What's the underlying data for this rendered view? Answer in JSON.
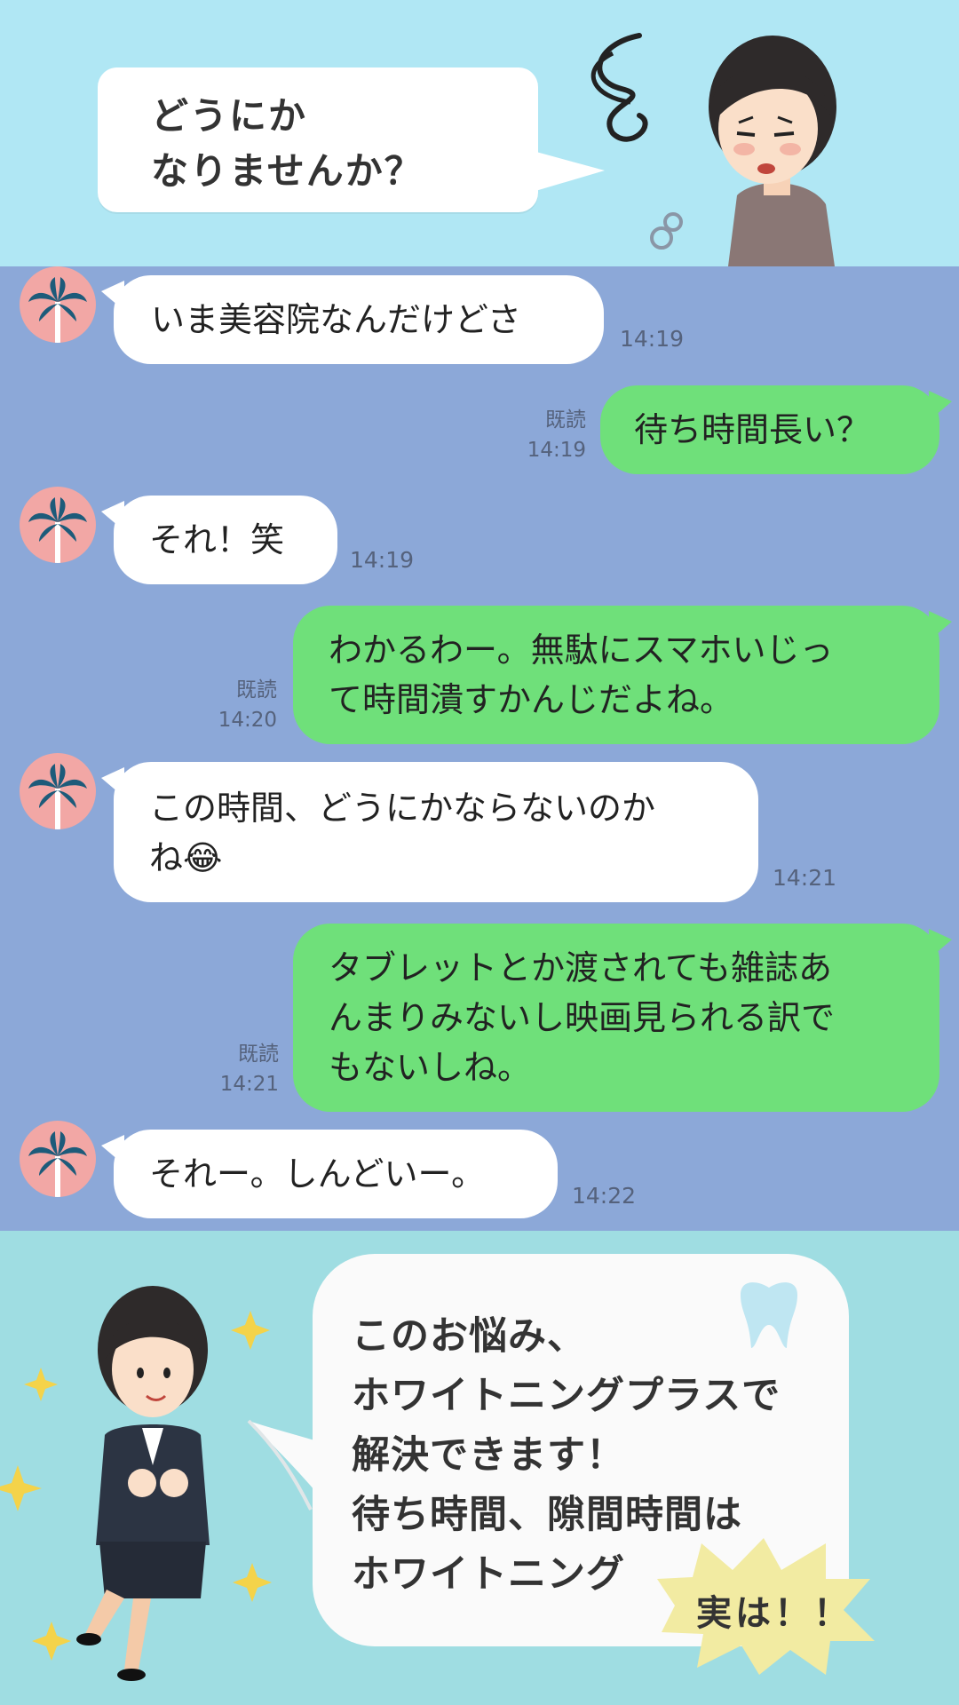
{
  "header": {
    "speech": "どうにか\nなりませんか？"
  },
  "messages": [
    {
      "side": "left",
      "text": "いま美容院なんだけどさ",
      "time": "14:19"
    },
    {
      "side": "right",
      "text": "待ち時間長い？",
      "read": "既読",
      "time": "14:19"
    },
    {
      "side": "left",
      "text": "それ！笑",
      "time": "14:19"
    },
    {
      "side": "right",
      "line1": "わかるわー。無駄にスマホいじっ",
      "line2": "て時間潰すかんじだよね。",
      "read": "既読",
      "time": "14:20"
    },
    {
      "side": "left",
      "line1": "この時間、どうにかならないのか",
      "line2": "ね",
      "emoji": "😂",
      "time": "14:21"
    },
    {
      "side": "right",
      "line1": "タブレットとか渡されても雑誌あ",
      "line2": "んまりみないし映画見られる訳で",
      "line3": "もないしね。",
      "read": "既読",
      "time": "14:21"
    },
    {
      "side": "left",
      "text": "それー。しんどいー。",
      "time": "14:22"
    }
  ],
  "promo": {
    "text": "このお悩み、\nホワイトニングプラスで\n解決できます！\n待ち時間、隙間時間は\nホワイトニング",
    "burst": "実は！！"
  },
  "colors": {
    "top_bg": "#b0e7f4",
    "chat_bg": "#8ca8d8",
    "bottom_bg": "#9fdde2",
    "sent": "#6fe07a",
    "received": "#ffffff"
  },
  "icons": [
    "palm-tree-avatar-icon",
    "tooth-icon",
    "sparkle-icon"
  ]
}
